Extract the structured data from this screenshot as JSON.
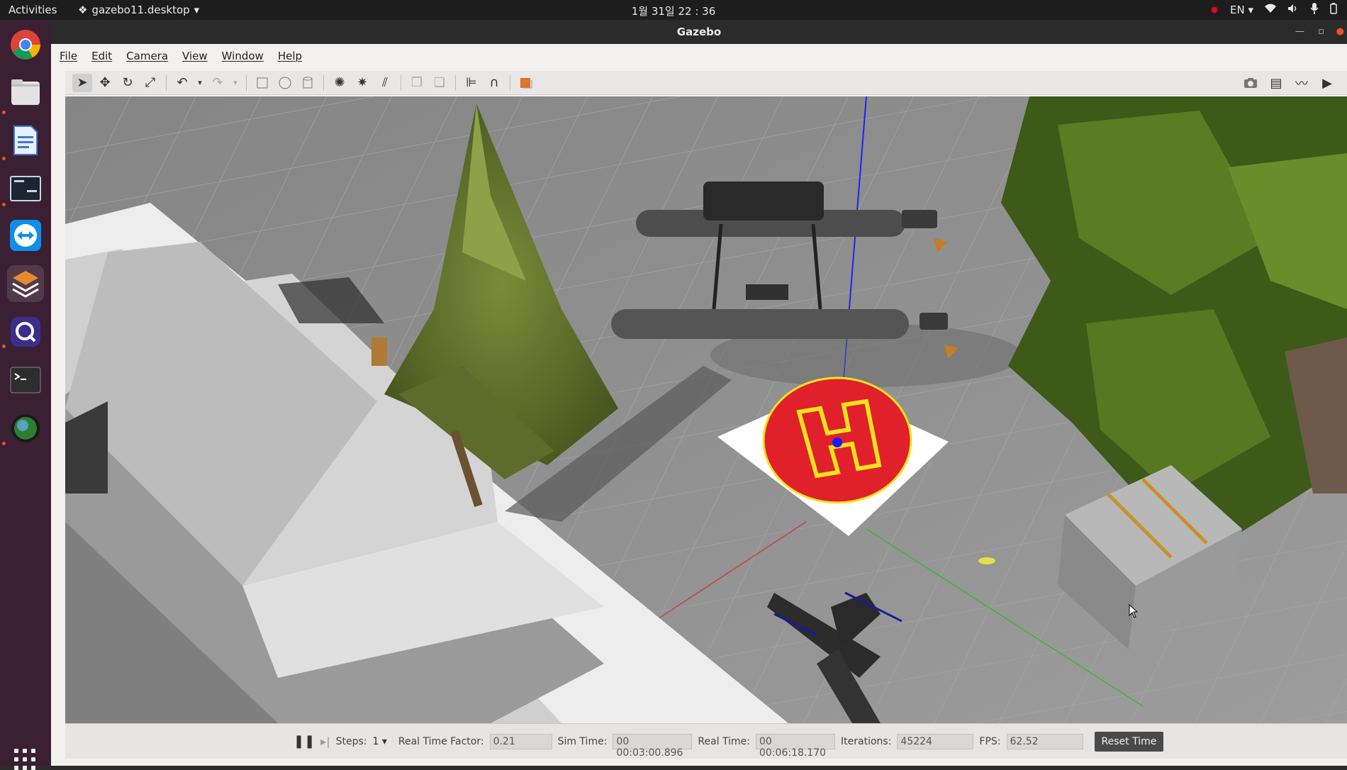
{
  "topbar": {
    "activities": "Activities",
    "app_name": "gazebo11.desktop",
    "clock": "1월 31일 22 : 36",
    "language": "EN"
  },
  "window": {
    "title": "Gazebo"
  },
  "menu": {
    "file": "File",
    "edit": "Edit",
    "camera": "Camera",
    "view": "View",
    "window": "Window",
    "help": "Help"
  },
  "bottom": {
    "steps_label": "Steps:",
    "steps_value": "1",
    "rtf_label": "Real Time Factor:",
    "rtf_value": "0.21",
    "sim_time_label": "Sim Time:",
    "sim_time_value": "00 00:03:00.896",
    "real_time_label": "Real Time:",
    "real_time_value": "00 00:06:18.170",
    "iterations_label": "Iterations:",
    "iterations_value": "45224",
    "fps_label": "FPS:",
    "fps_value": "62.52",
    "reset_label": "Reset Time"
  },
  "colors": {
    "dock_bg": "#3b1f33",
    "ground": "#8e8e8e",
    "helipad_red": "#e0202a",
    "helipad_yellow": "#f3e31c"
  }
}
